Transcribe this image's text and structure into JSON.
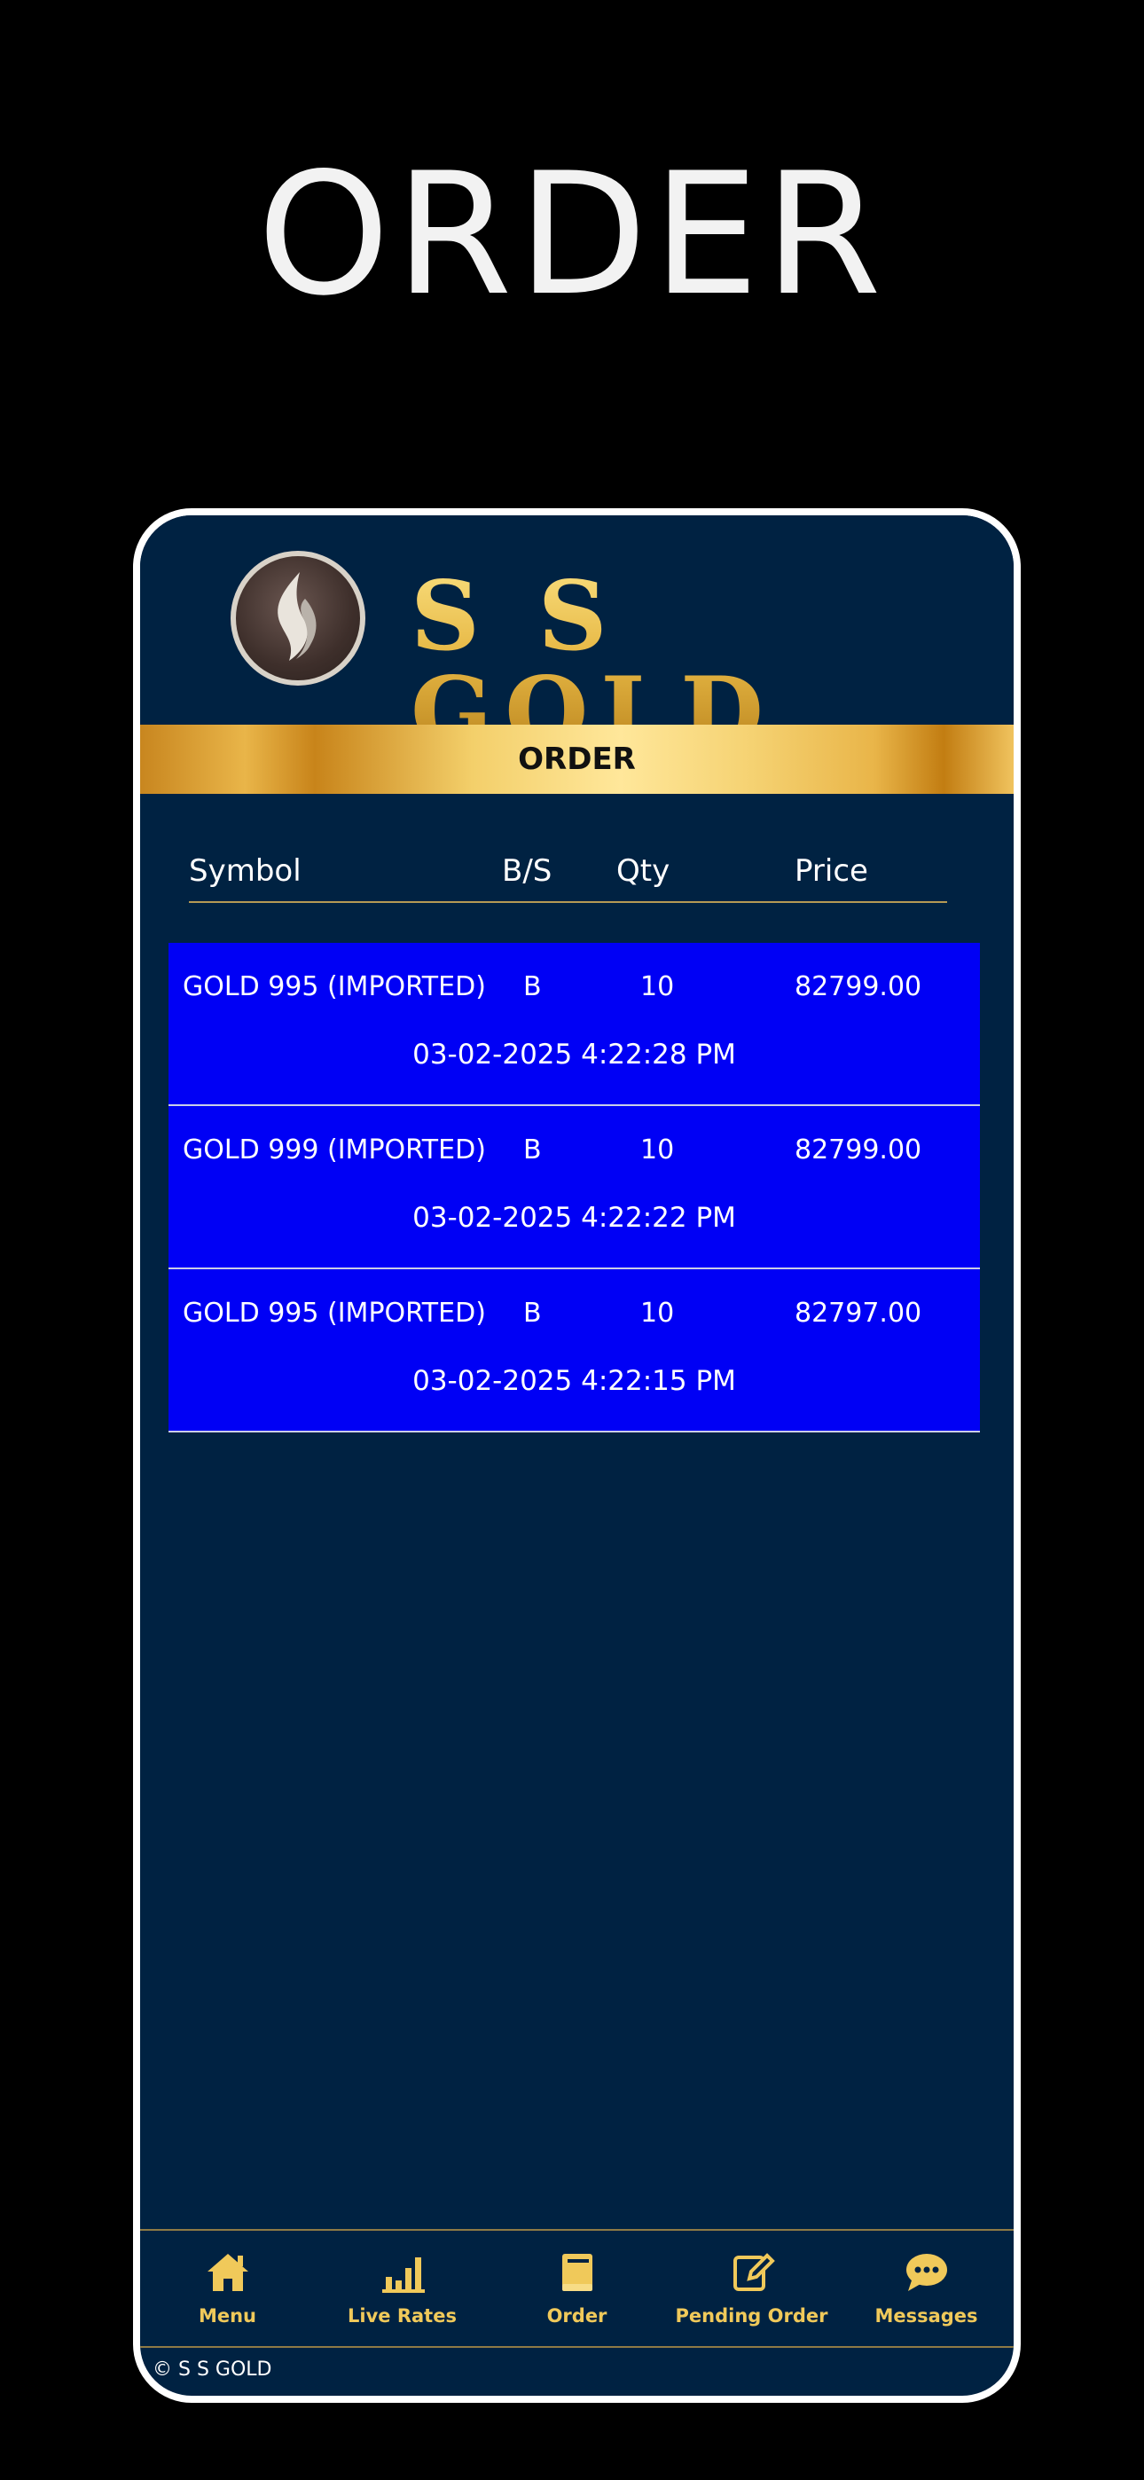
{
  "hero": {
    "title": "ORDER"
  },
  "app": {
    "brand": "S S GOLD",
    "page_title": "ORDER"
  },
  "table": {
    "columns": [
      "Symbol",
      "B/S",
      "Qty",
      "Price"
    ],
    "rows": [
      {
        "symbol": "GOLD 995 (IMPORTED)",
        "bs": "B",
        "qty": "10",
        "price": "82799.00",
        "time": "03-02-2025 4:22:28 PM"
      },
      {
        "symbol": "GOLD 999 (IMPORTED)",
        "bs": "B",
        "qty": "10",
        "price": "82799.00",
        "time": "03-02-2025 4:22:22 PM"
      },
      {
        "symbol": "GOLD 995 (IMPORTED)",
        "bs": "B",
        "qty": "10",
        "price": "82797.00",
        "time": "03-02-2025 4:22:15 PM"
      }
    ]
  },
  "nav": {
    "items": [
      {
        "label": "Menu",
        "icon": "home-icon"
      },
      {
        "label": "Live Rates",
        "icon": "bar-chart-icon"
      },
      {
        "label": "Order",
        "icon": "book-icon"
      },
      {
        "label": "Pending Order",
        "icon": "edit-icon"
      },
      {
        "label": "Messages",
        "icon": "chat-icon"
      }
    ]
  },
  "footer": {
    "text": "© S S GOLD"
  },
  "colors": {
    "background": "#000000",
    "app_bg": "#002242",
    "row_bg": "#0000f5",
    "gold": "#f0c95a"
  }
}
